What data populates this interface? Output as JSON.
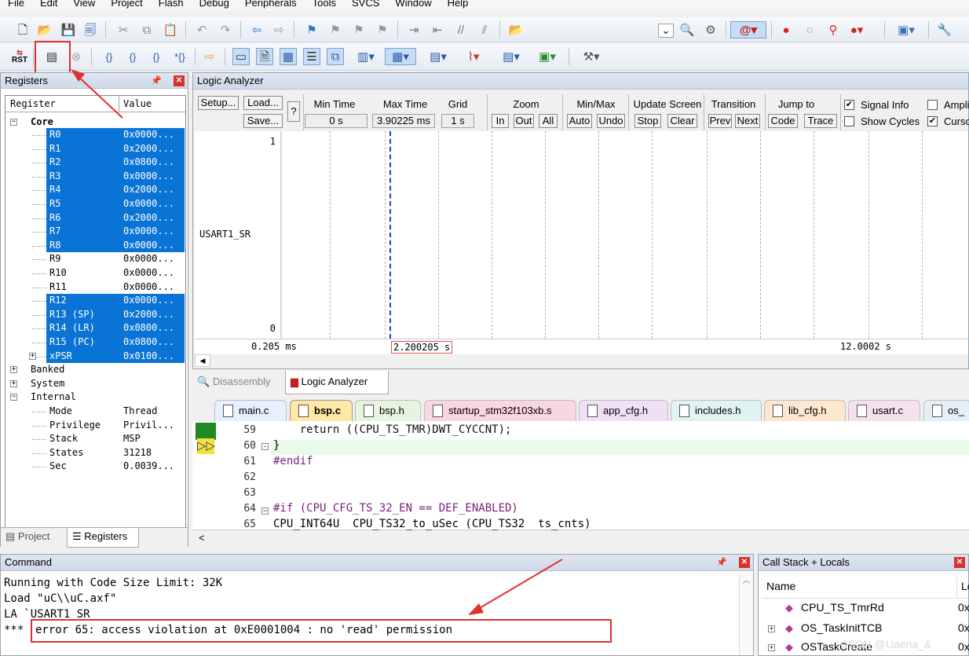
{
  "menu": [
    "File",
    "Edit",
    "View",
    "Project",
    "Flash",
    "Debug",
    "Peripherals",
    "Tools",
    "SVCS",
    "Window",
    "Help"
  ],
  "toolbar2": {
    "rst_label": "RST"
  },
  "registers": {
    "title": "Registers",
    "col_register": "Register",
    "col_value": "Value",
    "core_label": "Core",
    "rows": [
      {
        "name": "R0",
        "value": "0x0000...",
        "sel": true
      },
      {
        "name": "R1",
        "value": "0x2000...",
        "sel": true
      },
      {
        "name": "R2",
        "value": "0x0800...",
        "sel": true
      },
      {
        "name": "R3",
        "value": "0x0000...",
        "sel": true
      },
      {
        "name": "R4",
        "value": "0x2000...",
        "sel": true
      },
      {
        "name": "R5",
        "value": "0x0000...",
        "sel": true
      },
      {
        "name": "R6",
        "value": "0x2000...",
        "sel": true
      },
      {
        "name": "R7",
        "value": "0x0000...",
        "sel": true
      },
      {
        "name": "R8",
        "value": "0x0000...",
        "sel": true
      },
      {
        "name": "R9",
        "value": "0x0000...",
        "sel": false
      },
      {
        "name": "R10",
        "value": "0x0000...",
        "sel": false
      },
      {
        "name": "R11",
        "value": "0x0000...",
        "sel": false
      },
      {
        "name": "R12",
        "value": "0x0000...",
        "sel": true
      },
      {
        "name": "R13 (SP)",
        "value": "0x2000...",
        "sel": true
      },
      {
        "name": "R14 (LR)",
        "value": "0x0800...",
        "sel": true
      },
      {
        "name": "R15 (PC)",
        "value": "0x0800...",
        "sel": true
      },
      {
        "name": "xPSR",
        "value": "0x0100...",
        "sel": true
      }
    ],
    "groups": {
      "banked": "Banked",
      "system": "System",
      "internal": "Internal"
    },
    "internal": [
      {
        "name": "Mode",
        "value": "Thread"
      },
      {
        "name": "Privilege",
        "value": "Privil..."
      },
      {
        "name": "Stack",
        "value": "MSP"
      },
      {
        "name": "States",
        "value": "31218"
      },
      {
        "name": "Sec",
        "value": "0.0039..."
      }
    ],
    "tab_project": "Project",
    "tab_registers": "Registers"
  },
  "la": {
    "title": "Logic Analyzer",
    "setup": "Setup...",
    "load": "Load...",
    "save": "Save...",
    "help": "?",
    "min_time_label": "Min Time",
    "min_time": "0 s",
    "max_time_label": "Max Time",
    "max_time": "3.90225 ms",
    "grid_label": "Grid",
    "grid": "1 s",
    "zoom_label": "Zoom",
    "zoom_in": "In",
    "zoom_out": "Out",
    "zoom_all": "All",
    "minmax_label": "Min/Max",
    "auto": "Auto",
    "undo": "Undo",
    "update_label": "Update Screen",
    "stop": "Stop",
    "clear": "Clear",
    "transition_label": "Transition",
    "prev": "Prev",
    "next": "Next",
    "jumpto_label": "Jump to",
    "code": "Code",
    "trace": "Trace",
    "signal_info": "Signal Info",
    "show_cycles": "Show Cycles",
    "ampl": "Ampli",
    "cursor": "Curso",
    "signal": "USART1_SR",
    "ymax": "1",
    "ymin": "0",
    "t_left": "0.205 ms",
    "t_cursor": "2.200205 s",
    "t_right": "12.0002 s"
  },
  "lower_tabs": {
    "disassembly": "Disassembly",
    "logic_analyzer": "Logic Analyzer"
  },
  "file_tabs": [
    {
      "label": "main.c",
      "color": "#e6f0ff"
    },
    {
      "label": "bsp.c",
      "color": "#ffe7a8"
    },
    {
      "label": "bsp.h",
      "color": "#e6f4e0"
    },
    {
      "label": "startup_stm32f103xb.s",
      "color": "#f9d6e2"
    },
    {
      "label": "app_cfg.h",
      "color": "#efe0f6"
    },
    {
      "label": "includes.h",
      "color": "#dff3f3"
    },
    {
      "label": "lib_cfg.h",
      "color": "#fde8cf"
    },
    {
      "label": "usart.c",
      "color": "#f5e0ee"
    },
    {
      "label": "os_",
      "color": "#e6eef8"
    }
  ],
  "code": [
    {
      "ln": "59",
      "text": "    return ((CPU_TS_TMR)DWT_CYCCNT);"
    },
    {
      "ln": "60",
      "text": "}"
    },
    {
      "ln": "61",
      "text": "#endif"
    },
    {
      "ln": "62",
      "text": ""
    },
    {
      "ln": "63",
      "text": ""
    },
    {
      "ln": "64",
      "text": "#if (CPU_CFG_TS_32_EN == DEF_ENABLED)"
    },
    {
      "ln": "65",
      "text": "CPU_INT64U  CPU_TS32_to_uSec (CPU_TS32  ts_cnts)"
    }
  ],
  "command": {
    "title": "Command",
    "lines": [
      "Running with Code Size Limit: 32K",
      "Load \"uC\\\\uC.axf\"",
      "LA `USART1_SR"
    ],
    "err_prefix": "***",
    "error": "error 65: access violation at 0xE0001004 : no 'read' permission"
  },
  "callstack": {
    "title": "Call Stack + Locals",
    "col_name": "Name",
    "col_loc": "Lo",
    "rows": [
      {
        "name": "CPU_TS_TmrRd",
        "loc": "0x"
      },
      {
        "name": "OS_TaskInitTCB",
        "loc": "0x"
      },
      {
        "name": "OSTaskCreate",
        "loc": "0x"
      }
    ],
    "watermark": "CSDN @Uaena_&"
  }
}
